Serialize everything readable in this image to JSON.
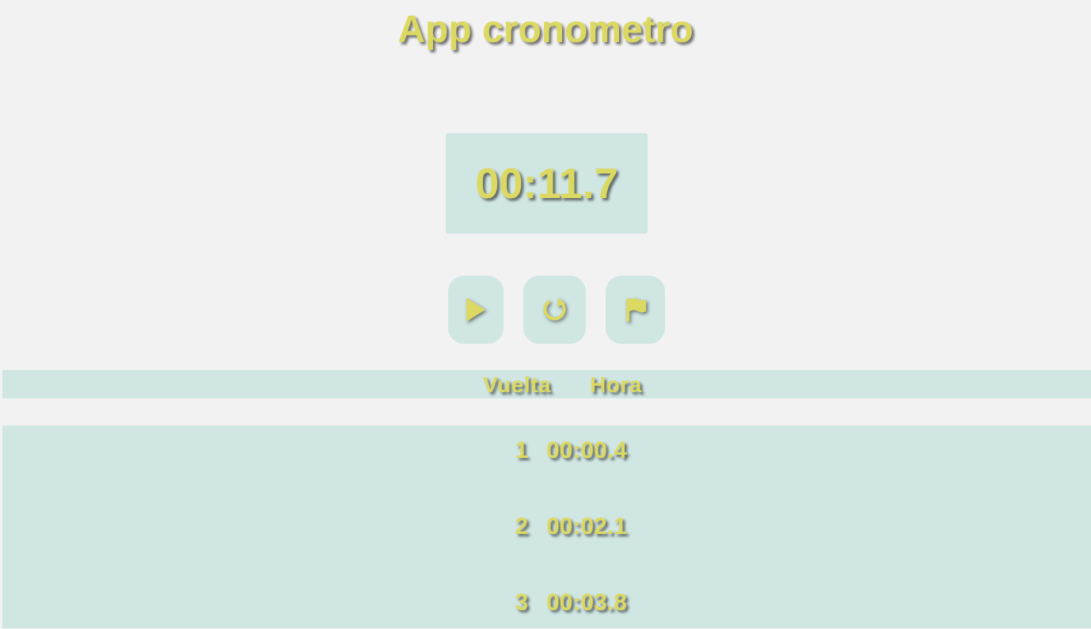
{
  "app": {
    "title": "App cronometro"
  },
  "stopwatch": {
    "display": "00:11.7"
  },
  "controls": {
    "play_icon": "play-icon",
    "reset_icon": "reset-icon",
    "lap_icon": "flag-icon"
  },
  "laps_table": {
    "headers": {
      "lap": "Vuelta",
      "time": "Hora"
    },
    "rows": [
      {
        "lap": "1",
        "time": "00:00.4"
      },
      {
        "lap": "2",
        "time": "00:02.1"
      },
      {
        "lap": "3",
        "time": "00:03.8"
      }
    ]
  },
  "colors": {
    "accent_text": "#dcd962",
    "panel": "#d0e6e3",
    "background": "#f2f2f2"
  }
}
